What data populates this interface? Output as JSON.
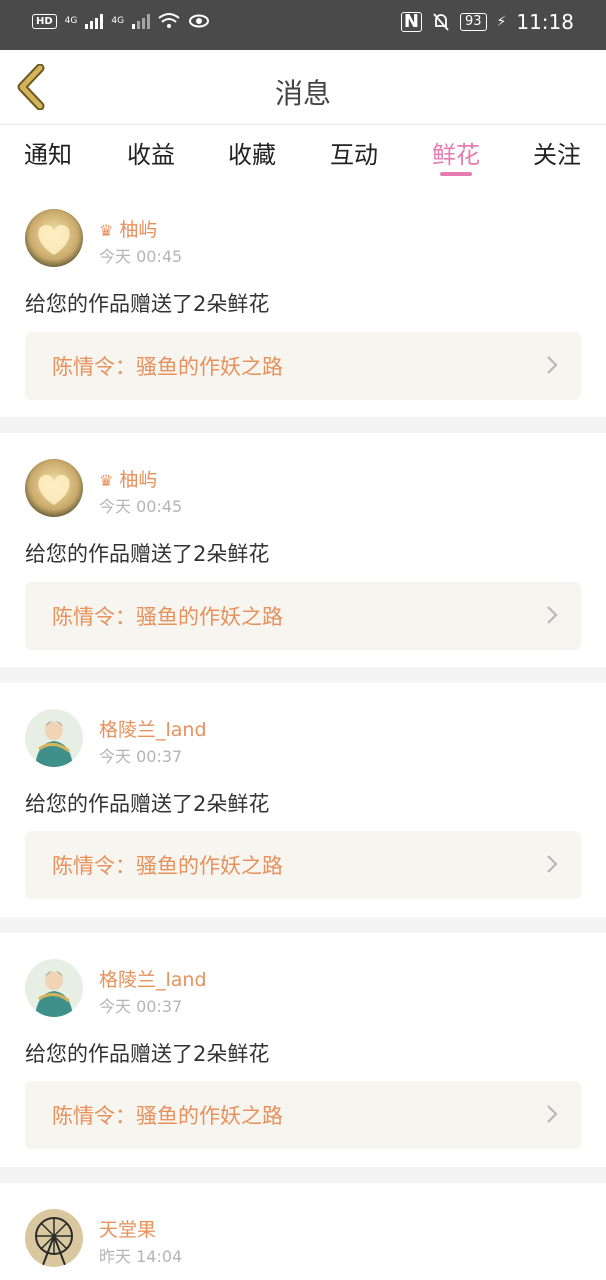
{
  "status_bar": {
    "hd": "HD",
    "net1": "4G",
    "net2": "4G",
    "nfc": "N",
    "battery": "93",
    "time": "11:18"
  },
  "nav": {
    "title": "消息"
  },
  "tabs": [
    {
      "label": "通知"
    },
    {
      "label": "收益"
    },
    {
      "label": "收藏"
    },
    {
      "label": "互动"
    },
    {
      "label": "鲜花",
      "active": true
    },
    {
      "label": "关注"
    }
  ],
  "messages": [
    {
      "crown": "♛",
      "user": "柚屿",
      "time": "今天 00:45",
      "text": "给您的作品赠送了2朵鲜花",
      "work": "陈情令：骚鱼的作妖之路",
      "avatar": "heart-avatar"
    },
    {
      "crown": "♛",
      "user": "柚屿",
      "time": "今天 00:45",
      "text": "给您的作品赠送了2朵鲜花",
      "work": "陈情令：骚鱼的作妖之路",
      "avatar": "heart-avatar"
    },
    {
      "crown": "",
      "user": "格陵兰_land",
      "time": "今天 00:37",
      "text": "给您的作品赠送了2朵鲜花",
      "work": "陈情令：骚鱼的作妖之路",
      "avatar": "character-avatar"
    },
    {
      "crown": "",
      "user": "格陵兰_land",
      "time": "今天 00:37",
      "text": "给您的作品赠送了2朵鲜花",
      "work": "陈情令：骚鱼的作妖之路",
      "avatar": "character-avatar"
    },
    {
      "crown": "",
      "user": "天堂果",
      "time": "昨天 14:04",
      "text": "",
      "work": "",
      "avatar": "ferris-wheel-avatar"
    }
  ],
  "colors": {
    "accent": "#e57bb0",
    "name": "#e8915c",
    "back": "#d4b35a"
  }
}
